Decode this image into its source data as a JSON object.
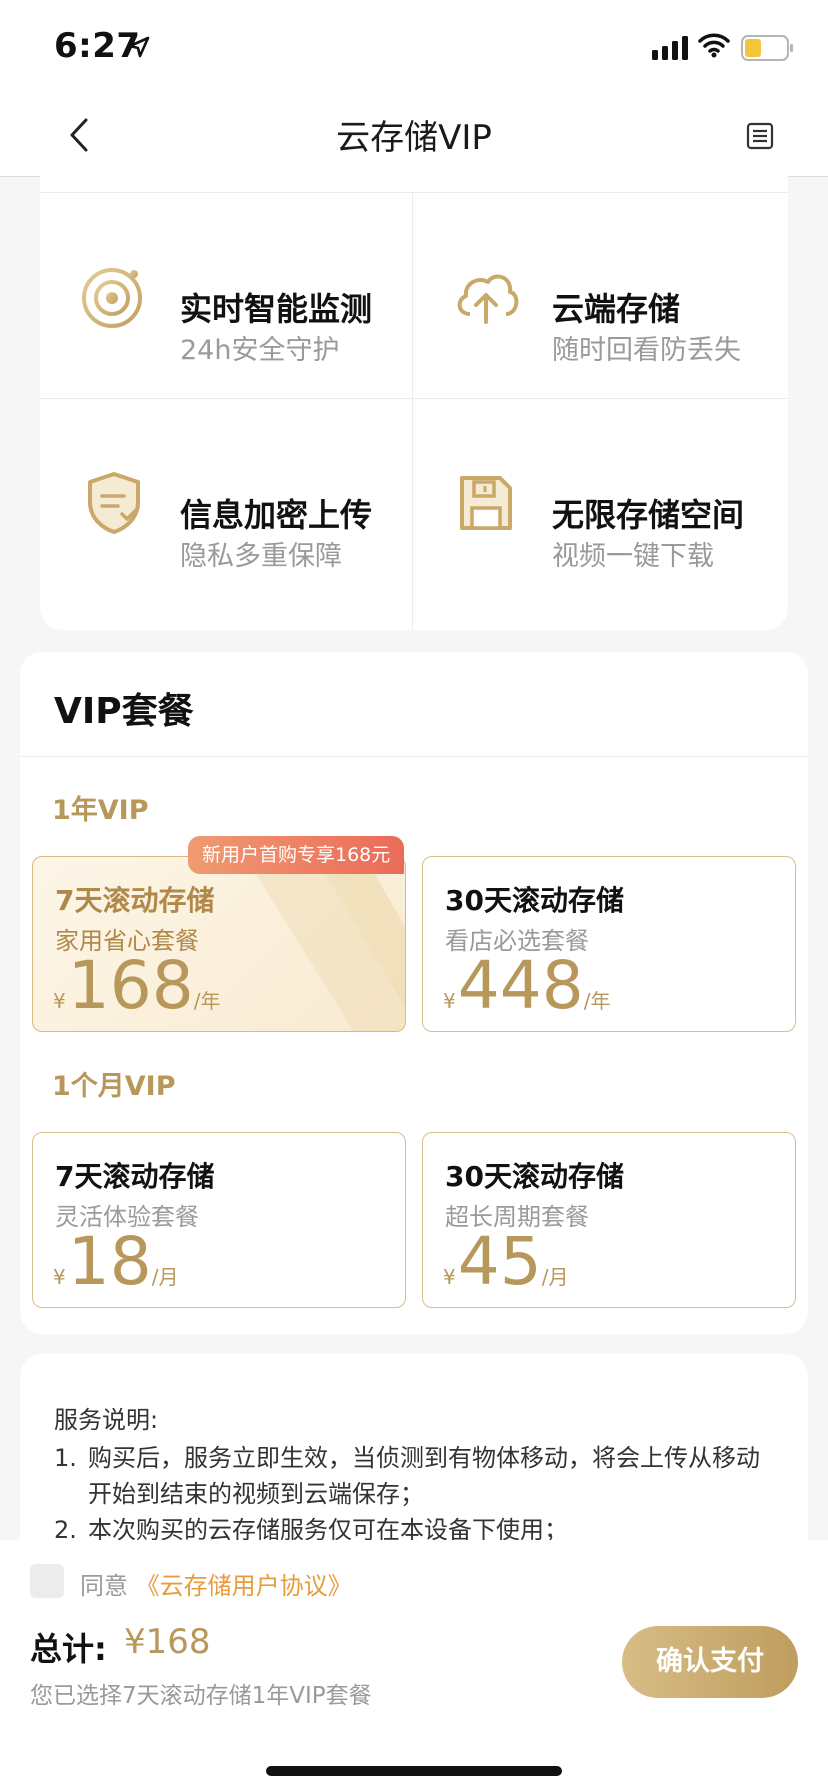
{
  "status_bar": {
    "time": "6:27"
  },
  "nav": {
    "title": "云存储VIP"
  },
  "features": [
    {
      "title": "实时智能监测",
      "subtitle": "24h安全守护",
      "icon": "monitor-target-icon"
    },
    {
      "title": "云端存储",
      "subtitle": "随时回看防丢失",
      "icon": "cloud-upload-icon"
    },
    {
      "title": "信息加密上传",
      "subtitle": "隐私多重保障",
      "icon": "shield-doc-icon"
    },
    {
      "title": "无限存储空间",
      "subtitle": "视频一键下载",
      "icon": "floppy-disk-icon"
    }
  ],
  "vip": {
    "title": "VIP套餐",
    "groups": [
      {
        "label": "1年VIP",
        "promo": "新用户首购专享168元",
        "plans": [
          {
            "name": "7天滚动存储",
            "desc": "家用省心套餐",
            "currency": "¥",
            "price": "168",
            "unit": "/年",
            "selected": true
          },
          {
            "name": "30天滚动存储",
            "desc": "看店必选套餐",
            "currency": "¥",
            "price": "448",
            "unit": "/年",
            "selected": false
          }
        ]
      },
      {
        "label": "1个月VIP",
        "plans": [
          {
            "name": "7天滚动存储",
            "desc": "灵活体验套餐",
            "currency": "¥",
            "price": "18",
            "unit": "/月",
            "selected": false
          },
          {
            "name": "30天滚动存储",
            "desc": "超长周期套餐",
            "currency": "¥",
            "price": "45",
            "unit": "/月",
            "selected": false
          }
        ]
      }
    ]
  },
  "service": {
    "title": "服务说明:",
    "items": [
      {
        "num": "1.",
        "line1": "购买后，服务立即生效，当侦测到有物体移动，将会上传从移动",
        "line2": "开始到结束的视频到云端保存；"
      },
      {
        "num": "2.",
        "line1": "本次购买的云存储服务仅可在本设备下使用；"
      }
    ]
  },
  "footer": {
    "agree_prefix": "同意",
    "agree_link": "《云存储用户协议》",
    "total_label": "总计:",
    "total_value": "¥168",
    "summary": "您已选择7天滚动存储1年VIP套餐",
    "pay_label": "确认支付"
  },
  "colors": {
    "gold": "#b8975a",
    "promo": "#ea6b58",
    "link": "#e89c3c"
  }
}
